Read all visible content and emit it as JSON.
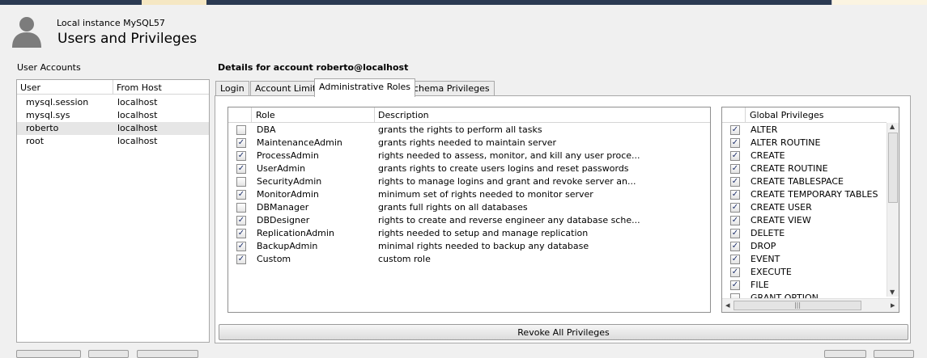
{
  "header": {
    "instance": "Local instance MySQL57",
    "title": "Users and Privileges"
  },
  "accounts": {
    "label": "User Accounts",
    "columns": [
      "User",
      "From Host"
    ],
    "rows": [
      {
        "user": "mysql.session",
        "host": "localhost"
      },
      {
        "user": "mysql.sys",
        "host": "localhost"
      },
      {
        "user": "roberto",
        "host": "localhost"
      },
      {
        "user": "root",
        "host": "localhost"
      }
    ],
    "selected_index": 2
  },
  "details": {
    "title": "Details for account roberto@localhost",
    "tabs": [
      "Login",
      "Account Limits",
      "Administrative Roles",
      "Schema Privileges"
    ],
    "active_tab_index": 2
  },
  "roles_table": {
    "columns": [
      "Role",
      "Description"
    ],
    "rows": [
      {
        "role": "DBA",
        "description": "grants the rights to perform all tasks",
        "checked": false
      },
      {
        "role": "MaintenanceAdmin",
        "description": "grants rights needed to maintain server",
        "checked": true
      },
      {
        "role": "ProcessAdmin",
        "description": "rights needed to assess, monitor, and kill any user proce...",
        "checked": true
      },
      {
        "role": "UserAdmin",
        "description": "grants rights to create users logins and reset passwords",
        "checked": true
      },
      {
        "role": "SecurityAdmin",
        "description": "rights to manage logins and grant and revoke server an...",
        "checked": false
      },
      {
        "role": "MonitorAdmin",
        "description": "minimum set of rights needed to monitor server",
        "checked": true
      },
      {
        "role": "DBManager",
        "description": "grants full rights on all databases",
        "checked": false
      },
      {
        "role": "DBDesigner",
        "description": "rights to create and reverse engineer any database sche...",
        "checked": true
      },
      {
        "role": "ReplicationAdmin",
        "description": "rights needed to setup and manage replication",
        "checked": true
      },
      {
        "role": "BackupAdmin",
        "description": "minimal rights needed to backup any database",
        "checked": true
      },
      {
        "role": "Custom",
        "description": "custom role",
        "checked": true
      }
    ]
  },
  "global_privileges": {
    "header": "Global Privileges",
    "rows": [
      {
        "name": "ALTER",
        "checked": true
      },
      {
        "name": "ALTER ROUTINE",
        "checked": true
      },
      {
        "name": "CREATE",
        "checked": true
      },
      {
        "name": "CREATE ROUTINE",
        "checked": true
      },
      {
        "name": "CREATE TABLESPACE",
        "checked": true
      },
      {
        "name": "CREATE TEMPORARY TABLES",
        "checked": true
      },
      {
        "name": "CREATE USER",
        "checked": true
      },
      {
        "name": "CREATE VIEW",
        "checked": true
      },
      {
        "name": "DELETE",
        "checked": true
      },
      {
        "name": "DROP",
        "checked": true
      },
      {
        "name": "EVENT",
        "checked": true
      },
      {
        "name": "EXECUTE",
        "checked": true
      },
      {
        "name": "FILE",
        "checked": true
      },
      {
        "name": "GRANT OPTION",
        "checked": false
      }
    ]
  },
  "buttons": {
    "revoke_all": "Revoke All Privileges"
  },
  "icons": {
    "avatar": "user-silhouette-icon",
    "checkmark": "✓",
    "scroll_up": "▲",
    "scroll_down": "▼",
    "scroll_left": "◂",
    "scroll_right": "▸",
    "thumb_grip": "|||"
  },
  "colors": {
    "topbar": "#2b3a52",
    "active_segment": "#f5e7c3",
    "selected_row": "#e6e6e6",
    "check": "#1d2f6b"
  }
}
